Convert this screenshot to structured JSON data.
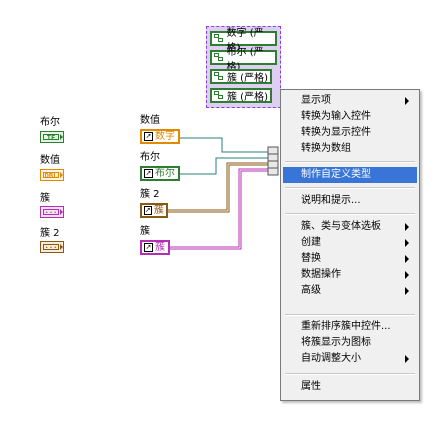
{
  "palette": {
    "items": [
      {
        "label": "布尔",
        "glyph": "TF",
        "color": "#2f7d32"
      },
      {
        "label": "数值",
        "glyph": "DBL",
        "color": "#e08a00"
      },
      {
        "label": "簇",
        "glyph": "···",
        "color": "#b52fb5"
      },
      {
        "label": "簇 2",
        "glyph": "···",
        "color": "#8a5a14"
      }
    ]
  },
  "diagram": {
    "terminals": [
      {
        "label": "数值",
        "text": "数字",
        "color": "#e08a00"
      },
      {
        "label": "布尔",
        "text": "布尔",
        "color": "#2f7d32"
      },
      {
        "label": "簇 2",
        "text": "簇",
        "color": "#8a5a14"
      },
      {
        "label": "簇",
        "text": "簇",
        "color": "#b52fb5"
      }
    ],
    "bundle_items": [
      {
        "text": "数字 (严格)"
      },
      {
        "text": "布尔 (严格)"
      },
      {
        "text": "簇 (严格)"
      },
      {
        "text": "簇 (严格)"
      }
    ],
    "wire_colors": {
      "cluster": "#8a5a14",
      "generic": "#2a7f7f"
    }
  },
  "context_menu": {
    "items": [
      {
        "label": "显示项",
        "submenu": true
      },
      {
        "label": "转换为输入控件"
      },
      {
        "label": "转换为显示控件"
      },
      {
        "label": "转换为数组"
      },
      {
        "label": "制作自定义类型",
        "highlighted": true
      },
      {
        "label": "说明和提示..."
      },
      {
        "label": "簇、类与变体选板",
        "submenu": true
      },
      {
        "label": "创建",
        "submenu": true
      },
      {
        "label": "替换",
        "submenu": true
      },
      {
        "label": "数据操作",
        "submenu": true
      },
      {
        "label": "高级",
        "submenu": true
      },
      {
        "label": "重新排序簇中控件..."
      },
      {
        "label": "将簇显示为图标"
      },
      {
        "label": "自动调整大小",
        "submenu": true
      },
      {
        "label": "属性"
      }
    ],
    "highlight_color": "#3875d7"
  }
}
